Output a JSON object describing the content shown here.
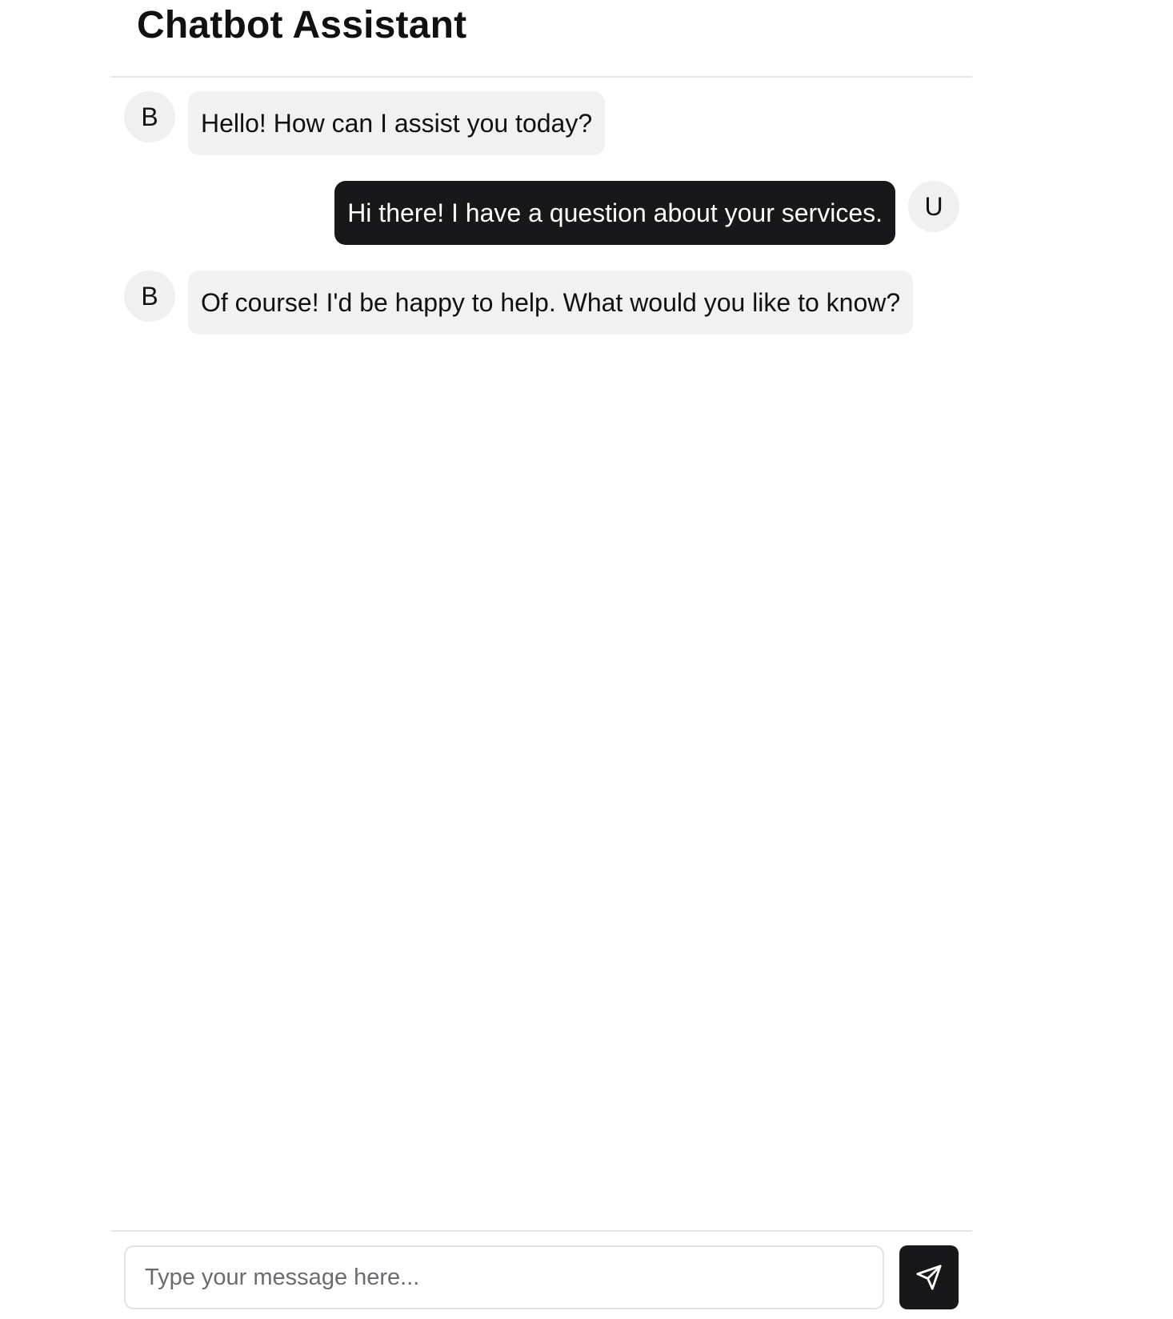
{
  "header": {
    "title": "Chatbot Assistant"
  },
  "messages": [
    {
      "sender": "bot",
      "avatar": "B",
      "text": "Hello! How can I assist you today?"
    },
    {
      "sender": "user",
      "avatar": "U",
      "text": "Hi there! I have a question about your services."
    },
    {
      "sender": "bot",
      "avatar": "B",
      "text": "Of course! I'd be happy to help. What would you like to know?"
    }
  ],
  "composer": {
    "input_value": "",
    "input_placeholder": "Type your message here...",
    "send_icon": "send-icon"
  },
  "colors": {
    "user_bubble": "#18181a",
    "bot_bubble": "#f1f1f1",
    "avatar_bg": "#f0f0f0",
    "divider": "#e4e4e4"
  }
}
